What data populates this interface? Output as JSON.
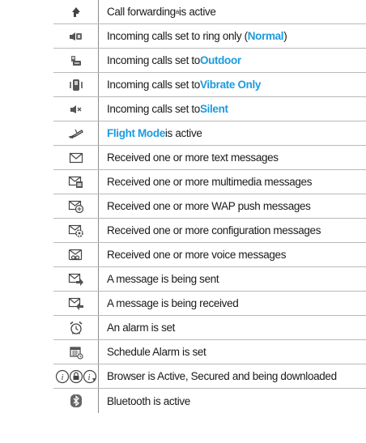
{
  "colors": {
    "highlight": "#1b9be0",
    "rule": "#b9b9b9",
    "divider": "#8c8c8c",
    "text": "#1a1a1a"
  },
  "rows": [
    {
      "icon": "call-forward-icon",
      "text": "Call forwarding",
      "sup": "a",
      "text2": " is active"
    },
    {
      "icon": "normal-ring-icon",
      "text": "Incoming calls set to ring only (",
      "hl": "Normal",
      "after": ")"
    },
    {
      "icon": "outdoor-icon",
      "text": "Incoming calls set to ",
      "hl": "Outdoor",
      "after": ""
    },
    {
      "icon": "vibrate-icon",
      "text": "Incoming calls set to ",
      "hl": "Vibrate Only",
      "after": ""
    },
    {
      "icon": "silent-icon",
      "text": "Incoming calls set to ",
      "hl": "Silent",
      "after": ""
    },
    {
      "icon": "flight-mode-icon",
      "text": "",
      "hl": "Flight Mode",
      "after": " is active"
    },
    {
      "icon": "text-message-icon",
      "text": "Received one or more text messages"
    },
    {
      "icon": "multimedia-message-icon",
      "text": "Received one or more multimedia messages"
    },
    {
      "icon": "wap-push-icon",
      "text": "Received one or more WAP push messages"
    },
    {
      "icon": "configuration-message-icon",
      "text": "Received one or more configuration messages"
    },
    {
      "icon": "voice-message-icon",
      "text": "Received one or more voice messages"
    },
    {
      "icon": "sending-message-icon",
      "text": "A message is being sent"
    },
    {
      "icon": "receiving-message-icon",
      "text": "A message is being received"
    },
    {
      "icon": "alarm-icon",
      "text": "An alarm is set"
    },
    {
      "icon": "schedule-alarm-icon",
      "text": "Schedule Alarm is set"
    },
    {
      "icon": "browser-status-icon",
      "text": "Browser is Active, Secured and being downloaded"
    },
    {
      "icon": "bluetooth-icon",
      "text": "Bluetooth is active"
    }
  ]
}
